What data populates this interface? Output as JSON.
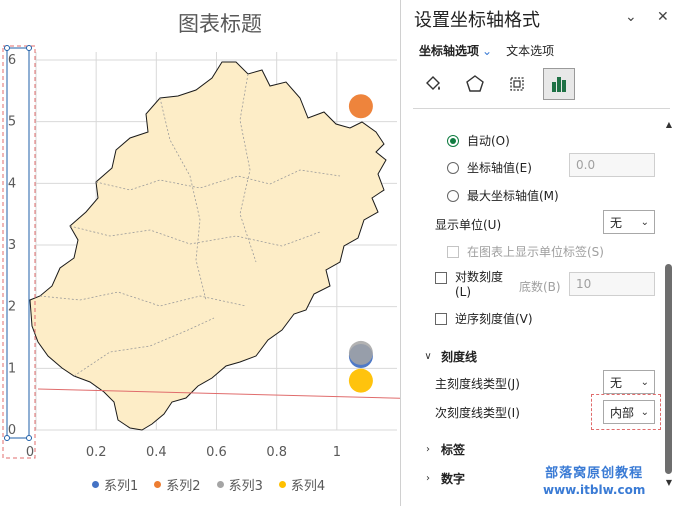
{
  "chart": {
    "title": "图表标题",
    "y_axis_ticks": [
      "0",
      "1",
      "2",
      "3",
      "4",
      "5",
      "6"
    ],
    "x_axis_ticks": [
      "0",
      "0.2",
      "0.4",
      "0.6",
      "0.8",
      "1"
    ],
    "legend": [
      {
        "label": "系列1",
        "color": "#4472c4"
      },
      {
        "label": "系列2",
        "color": "#ed7d31"
      },
      {
        "label": "系列3",
        "color": "#a5a5a5"
      },
      {
        "label": "系列4",
        "color": "#ffc000"
      }
    ]
  },
  "chart_data": {
    "type": "scatter",
    "title": "图表标题",
    "xlim": [
      0,
      1.2
    ],
    "ylim": [
      0,
      6
    ],
    "grid": true,
    "legend_position": "bottom",
    "series": [
      {
        "name": "系列1",
        "color": "#4472c4",
        "x": [
          1.08
        ],
        "y": [
          1.2
        ]
      },
      {
        "name": "系列2",
        "color": "#ed7d31",
        "x": [
          1.08
        ],
        "y": [
          5.25
        ]
      },
      {
        "name": "系列3",
        "color": "#a5a5a5",
        "x": [
          1.08
        ],
        "y": [
          1.25
        ]
      },
      {
        "name": "系列4",
        "color": "#ffc000",
        "x": [
          1.08
        ],
        "y": [
          0.8
        ]
      }
    ]
  },
  "pane": {
    "title": "设置坐标轴格式",
    "tab_axis_options": "坐标轴选项",
    "tab_text_options": "文本选项",
    "auto_label": "自动(O)",
    "axis_value_label": "坐标轴值(E)",
    "axis_value_input": "0.0",
    "max_axis_value_label": "最大坐标轴值(M)",
    "display_units_label": "显示单位(U)",
    "display_units_value": "无",
    "show_units_label": "在图表上显示单位标签(S)",
    "log_scale_label": "对数刻度",
    "log_scale_label_line2": "(L)",
    "base_label": "底数(B)",
    "base_value": "10",
    "reverse_order_label": "逆序刻度值(V)",
    "tick_marks_header": "刻度线",
    "major_tick_label": "主刻度线类型(J)",
    "major_tick_value": "无",
    "minor_tick_label": "次刻度线类型(I)",
    "minor_tick_value": "内部",
    "labels_header": "标签",
    "number_header": "数字"
  },
  "watermark": {
    "line1": "部落窝原创教程",
    "line2": "www.itblw.com"
  }
}
